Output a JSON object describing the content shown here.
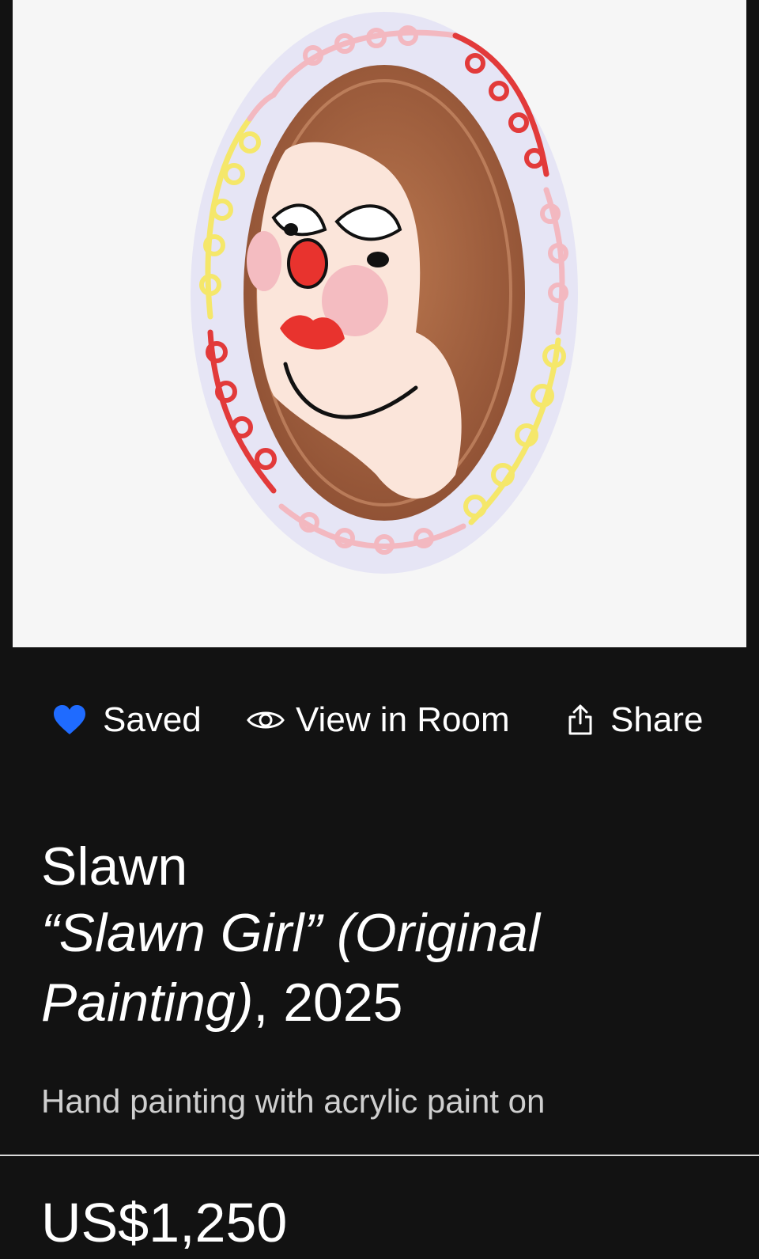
{
  "artwork": {
    "image_alt": "Painted oval plate with portrait of a girl"
  },
  "actions": {
    "saved_label": "Saved",
    "view_in_room_label": "View in Room",
    "share_label": "Share",
    "saved_icon_color": "#1f6bff"
  },
  "artist": {
    "name": "Slawn"
  },
  "work": {
    "title": "“Slawn Girl” (Original Painting)",
    "separator": ", ",
    "year": "2025"
  },
  "description": {
    "text": "Hand painting with acrylic paint on"
  },
  "pricing": {
    "price": "US$1,250"
  },
  "icons": {
    "saved": "heart-icon",
    "view_in_room": "eye-icon",
    "share": "share-icon"
  }
}
